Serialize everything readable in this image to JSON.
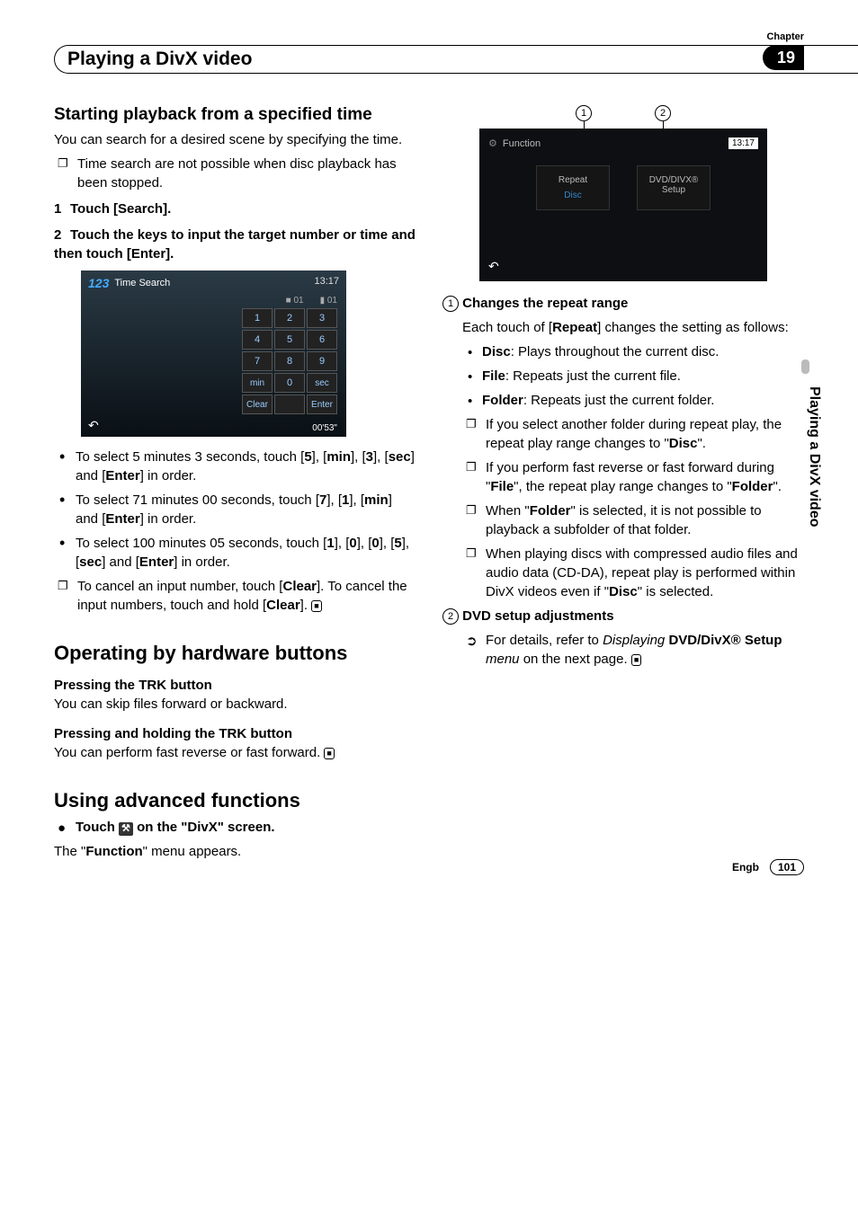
{
  "chapter": {
    "label": "Chapter",
    "number": "19"
  },
  "page_title": "Playing a DivX video",
  "side_tab": "Playing a DivX video",
  "footer": {
    "lang": "Engb",
    "page": "101"
  },
  "left": {
    "h2": "Starting playback from a specified time",
    "intro": "You can search for a desired scene by specifying the time.",
    "note1": "Time search are not possible when disc playback has been stopped.",
    "step1": "Touch [Search].",
    "step2": "Touch the keys to input the target number or time and then touch [Enter].",
    "shot1": {
      "icon": "123",
      "title": "Time Search",
      "time": "13:17",
      "sub_a": "01",
      "sub_b": "01",
      "kp": [
        [
          "1",
          "2",
          "3"
        ],
        [
          "4",
          "5",
          "6"
        ],
        [
          "7",
          "8",
          "9"
        ],
        [
          "min",
          "0",
          "sec"
        ],
        [
          "Clear",
          "",
          "Enter"
        ]
      ],
      "elapsed": "00'53\""
    },
    "ex1_a": "To select 5 minutes 3 seconds, touch [",
    "ex1_b": "], [",
    "ex1_c": "], [",
    "ex1_d": "], [",
    "ex1_e": "] and [",
    "ex1_f": "] in order.",
    "kw_5": "5",
    "kw_min": "min",
    "kw_3": "3",
    "kw_sec": "sec",
    "kw_enter": "Enter",
    "ex2_a": "To select 71 minutes 00 seconds, touch [",
    "ex2_b": "], [",
    "ex2_c": "], [",
    "ex2_d": "] and [",
    "ex2_e": "] in order.",
    "kw_7": "7",
    "kw_1": "1",
    "ex3_a": "To select 100 minutes 05 seconds, touch [",
    "ex3_b": "], [",
    "ex3_c": "], [",
    "ex3_d": "], [",
    "ex3_e": "], [",
    "ex3_f": "] and [",
    "ex3_g": "] in order.",
    "kw_0": "0",
    "cancel_a": "To cancel an input number, touch [",
    "cancel_b": "]. To cancel the input numbers, touch and hold [",
    "cancel_c": "].",
    "kw_clear": "Clear",
    "h3a": "Operating by hardware buttons",
    "h4a": "Pressing the TRK button",
    "h4a_pre": "Pressing the ",
    "h4a_btn": "TRK",
    "h4a_post": " button",
    "trk1": "You can skip files forward or backward.",
    "h4b_pre": "Pressing and holding the ",
    "h4b_btn": "TRK",
    "h4b_post": " button",
    "trk2": "You can perform fast reverse or fast forward.",
    "h3b": "Using advanced functions",
    "adv_pre": "Touch ",
    "adv_post": " on the \"DivX\" screen.",
    "adv2": "The \"",
    "adv2_kw": "Function",
    "adv2_end": "\" menu appears."
  },
  "right": {
    "callout1": "1",
    "callout2": "2",
    "shot2": {
      "func_label": "Function",
      "time": "13:17",
      "repeat": "Repeat",
      "repeat_sub": "Disc",
      "setup_l1": "DVD/DIVX®",
      "setup_l2": "Setup"
    },
    "item1_title": "Changes the repeat range",
    "item1_a": "Each touch of [",
    "item1_kw": "Repeat",
    "item1_b": "] changes the setting as follows:",
    "b1_a": "",
    "b1_kw": "Disc",
    "b1_b": ": Plays throughout the current disc.",
    "b2_kw": "File",
    "b2_b": ": Repeats just the current file.",
    "b3_kw": "Folder",
    "b3_b": ": Repeats just the current folder.",
    "sq1_a": "If you select another folder during repeat play, the repeat play range changes to \"",
    "sq1_kw": "Disc",
    "sq1_b": "\".",
    "sq2_a": "If you perform fast reverse or fast forward during \"",
    "sq2_kw1": "File",
    "sq2_b": "\", the repeat play range changes to \"",
    "sq2_kw2": "Folder",
    "sq2_c": "\".",
    "sq3_a": "When \"",
    "sq3_kw": "Folder",
    "sq3_b": "\" is selected, it is not possible to playback a subfolder of that folder.",
    "sq4_a": "When playing discs with compressed audio files and audio data (CD-DA), repeat play is performed within DivX videos even if \"",
    "sq4_kw": "Disc",
    "sq4_b": "\" is selected.",
    "item2_title": "DVD setup adjustments",
    "ref_a": "For details, refer to ",
    "ref_i": "Displaying ",
    "ref_kw": "DVD/DivX® Setup",
    "ref_i2": " menu",
    "ref_b": " on the next page."
  }
}
